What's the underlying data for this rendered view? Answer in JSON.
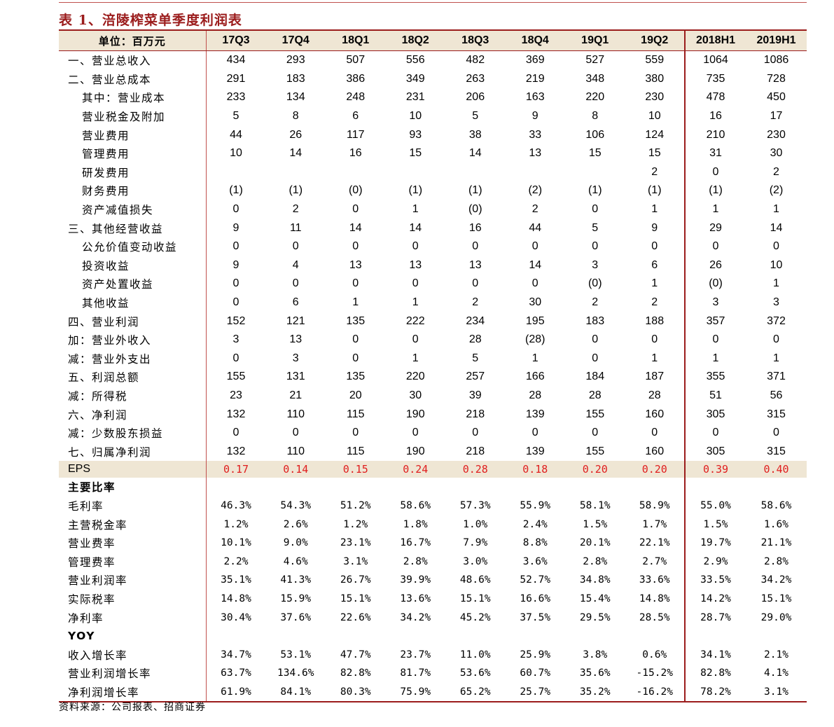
{
  "title": "表 1、涪陵榨菜单季度利润表",
  "columns": [
    "单位：百万元",
    "17Q3",
    "17Q4",
    "18Q1",
    "18Q2",
    "18Q3",
    "18Q4",
    "19Q1",
    "19Q2",
    "2018H1",
    "2019H1"
  ],
  "rows": [
    {
      "label": "一、营业总收入",
      "indent": 0,
      "values": [
        "434",
        "293",
        "507",
        "556",
        "482",
        "369",
        "527",
        "559",
        "1064",
        "1086"
      ]
    },
    {
      "label": "二、营业总成本",
      "indent": 0,
      "values": [
        "291",
        "183",
        "386",
        "349",
        "263",
        "219",
        "348",
        "380",
        "735",
        "728"
      ]
    },
    {
      "label": "其中：营业成本",
      "indent": 1,
      "values": [
        "233",
        "134",
        "248",
        "231",
        "206",
        "163",
        "220",
        "230",
        "478",
        "450"
      ]
    },
    {
      "label": "营业税金及附加",
      "indent": 1,
      "values": [
        "5",
        "8",
        "6",
        "10",
        "5",
        "9",
        "8",
        "10",
        "16",
        "17"
      ]
    },
    {
      "label": "营业费用",
      "indent": 1,
      "values": [
        "44",
        "26",
        "117",
        "93",
        "38",
        "33",
        "106",
        "124",
        "210",
        "230"
      ]
    },
    {
      "label": "管理费用",
      "indent": 1,
      "values": [
        "10",
        "14",
        "16",
        "15",
        "14",
        "13",
        "15",
        "15",
        "31",
        "30"
      ]
    },
    {
      "label": "研发费用",
      "indent": 1,
      "values": [
        "",
        "",
        "",
        "",
        "",
        "",
        "",
        "2",
        "0",
        "2"
      ]
    },
    {
      "label": "财务费用",
      "indent": 1,
      "values": [
        "(1)",
        "(1)",
        "(0)",
        "(1)",
        "(1)",
        "(2)",
        "(1)",
        "(1)",
        "(1)",
        "(2)"
      ]
    },
    {
      "label": "资产减值损失",
      "indent": 1,
      "values": [
        "0",
        "2",
        "0",
        "1",
        "(0)",
        "2",
        "0",
        "1",
        "1",
        "1"
      ]
    },
    {
      "label": "三、其他经营收益",
      "indent": 0,
      "values": [
        "9",
        "11",
        "14",
        "14",
        "16",
        "44",
        "5",
        "9",
        "29",
        "14"
      ]
    },
    {
      "label": "公允价值变动收益",
      "indent": 1,
      "values": [
        "0",
        "0",
        "0",
        "0",
        "0",
        "0",
        "0",
        "0",
        "0",
        "0"
      ]
    },
    {
      "label": "投资收益",
      "indent": 1,
      "values": [
        "9",
        "4",
        "13",
        "13",
        "13",
        "14",
        "3",
        "6",
        "26",
        "10"
      ]
    },
    {
      "label": "资产处置收益",
      "indent": 1,
      "values": [
        "0",
        "0",
        "0",
        "0",
        "0",
        "0",
        "(0)",
        "1",
        "(0)",
        "1"
      ]
    },
    {
      "label": "其他收益",
      "indent": 1,
      "values": [
        "0",
        "6",
        "1",
        "1",
        "2",
        "30",
        "2",
        "2",
        "3",
        "3"
      ]
    },
    {
      "label": "四、营业利润",
      "indent": 0,
      "values": [
        "152",
        "121",
        "135",
        "222",
        "234",
        "195",
        "183",
        "188",
        "357",
        "372"
      ]
    },
    {
      "label": "加：营业外收入",
      "indent": 0,
      "values": [
        "3",
        "13",
        "0",
        "0",
        "28",
        "(28)",
        "0",
        "0",
        "0",
        "0"
      ]
    },
    {
      "label": "减：营业外支出",
      "indent": 0,
      "values": [
        "0",
        "3",
        "0",
        "1",
        "5",
        "1",
        "0",
        "1",
        "1",
        "1"
      ]
    },
    {
      "label": "五、利润总额",
      "indent": 0,
      "values": [
        "155",
        "131",
        "135",
        "220",
        "257",
        "166",
        "184",
        "187",
        "355",
        "371"
      ]
    },
    {
      "label": "减：所得税",
      "indent": 0,
      "values": [
        "23",
        "21",
        "20",
        "30",
        "39",
        "28",
        "28",
        "28",
        "51",
        "56"
      ]
    },
    {
      "label": "六、净利润",
      "indent": 0,
      "values": [
        "132",
        "110",
        "115",
        "190",
        "218",
        "139",
        "155",
        "160",
        "305",
        "315"
      ]
    },
    {
      "label": "减：少数股东损益",
      "indent": 0,
      "values": [
        "0",
        "0",
        "0",
        "0",
        "0",
        "0",
        "0",
        "0",
        "0",
        "0"
      ]
    },
    {
      "label": "七、归属净利润",
      "indent": 0,
      "values": [
        "132",
        "110",
        "115",
        "190",
        "218",
        "139",
        "155",
        "160",
        "305",
        "315"
      ]
    }
  ],
  "eps": {
    "label": "EPS",
    "values": [
      "0.17",
      "0.14",
      "0.15",
      "0.24",
      "0.28",
      "0.18",
      "0.20",
      "0.20",
      "0.39",
      "0.40"
    ]
  },
  "ratios": {
    "heading": "主要比率",
    "rows": [
      {
        "label": "毛利率",
        "values": [
          "46.3%",
          "54.3%",
          "51.2%",
          "58.6%",
          "57.3%",
          "55.9%",
          "58.1%",
          "58.9%",
          "55.0%",
          "58.6%"
        ]
      },
      {
        "label": "主营税金率",
        "values": [
          "1.2%",
          "2.6%",
          "1.2%",
          "1.8%",
          "1.0%",
          "2.4%",
          "1.5%",
          "1.7%",
          "1.5%",
          "1.6%"
        ]
      },
      {
        "label": "营业费率",
        "values": [
          "10.1%",
          "9.0%",
          "23.1%",
          "16.7%",
          "7.9%",
          "8.8%",
          "20.1%",
          "22.1%",
          "19.7%",
          "21.1%"
        ]
      },
      {
        "label": "管理费率",
        "values": [
          "2.2%",
          "4.6%",
          "3.1%",
          "2.8%",
          "3.0%",
          "3.6%",
          "2.8%",
          "2.7%",
          "2.9%",
          "2.8%"
        ]
      },
      {
        "label": "营业利润率",
        "values": [
          "35.1%",
          "41.3%",
          "26.7%",
          "39.9%",
          "48.6%",
          "52.7%",
          "34.8%",
          "33.6%",
          "33.5%",
          "34.2%"
        ]
      },
      {
        "label": "实际税率",
        "values": [
          "14.8%",
          "15.9%",
          "15.1%",
          "13.6%",
          "15.1%",
          "16.6%",
          "15.4%",
          "14.8%",
          "14.2%",
          "15.1%"
        ]
      },
      {
        "label": "净利率",
        "values": [
          "30.4%",
          "37.6%",
          "22.6%",
          "34.2%",
          "45.2%",
          "37.5%",
          "29.5%",
          "28.5%",
          "28.7%",
          "29.0%"
        ]
      }
    ]
  },
  "yoy": {
    "heading": "YOY",
    "rows": [
      {
        "label": "收入增长率",
        "values": [
          "34.7%",
          "53.1%",
          "47.7%",
          "23.7%",
          "11.0%",
          "25.9%",
          "3.8%",
          "0.6%",
          "34.1%",
          "2.1%"
        ]
      },
      {
        "label": "营业利润增长率",
        "values": [
          "63.7%",
          "134.6%",
          "82.8%",
          "81.7%",
          "53.6%",
          "60.7%",
          "35.6%",
          "-15.2%",
          "82.8%",
          "4.1%"
        ]
      },
      {
        "label": "净利润增长率",
        "values": [
          "61.9%",
          "84.1%",
          "80.3%",
          "75.9%",
          "65.2%",
          "25.7%",
          "35.2%",
          "-16.2%",
          "78.2%",
          "3.1%"
        ]
      }
    ]
  },
  "source": "资料来源：公司报表、招商证券"
}
